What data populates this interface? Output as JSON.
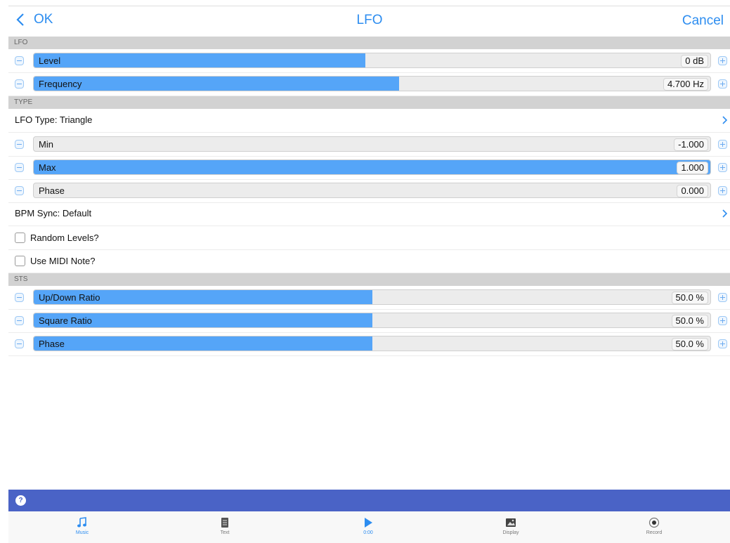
{
  "nav": {
    "back_label": "OK",
    "title": "LFO",
    "cancel_label": "Cancel"
  },
  "sections": {
    "lfo": "LFO",
    "type": "TYPE",
    "sts": "STS"
  },
  "lfo_sliders": [
    {
      "label": "Level",
      "value": "0 dB",
      "fill": 0.49
    },
    {
      "label": "Frequency",
      "value": "4.700 Hz",
      "fill": 0.54
    }
  ],
  "type_rows": {
    "lfo_type": "LFO Type: Triangle",
    "sliders": [
      {
        "label": "Min",
        "value": "-1.000",
        "fill": 0.0
      },
      {
        "label": "Max",
        "value": "1.000",
        "fill": 1.0
      },
      {
        "label": "Phase",
        "value": "0.000",
        "fill": 0.0
      }
    ],
    "bpm_sync": "BPM Sync: Default",
    "random_levels": "Random Levels?",
    "use_midi_note": "Use MIDI Note?"
  },
  "sts_sliders": [
    {
      "label": "Up/Down Ratio",
      "value": "50.0 %",
      "fill": 0.5
    },
    {
      "label": "Square Ratio",
      "value": "50.0 %",
      "fill": 0.5
    },
    {
      "label": "Phase",
      "value": "50.0 %",
      "fill": 0.5
    }
  ],
  "help_icon_text": "?",
  "tabs": [
    {
      "label": "Music",
      "icon": "music-note-icon"
    },
    {
      "label": "Text",
      "icon": "text-document-icon"
    },
    {
      "label": "0:00",
      "icon": "play-icon"
    },
    {
      "label": "Display",
      "icon": "image-icon"
    },
    {
      "label": "Record",
      "icon": "record-icon"
    }
  ],
  "colors": {
    "accent": "#2d8df0",
    "slider_fill": "#55a5f8",
    "help_bar": "#4a63c6"
  }
}
